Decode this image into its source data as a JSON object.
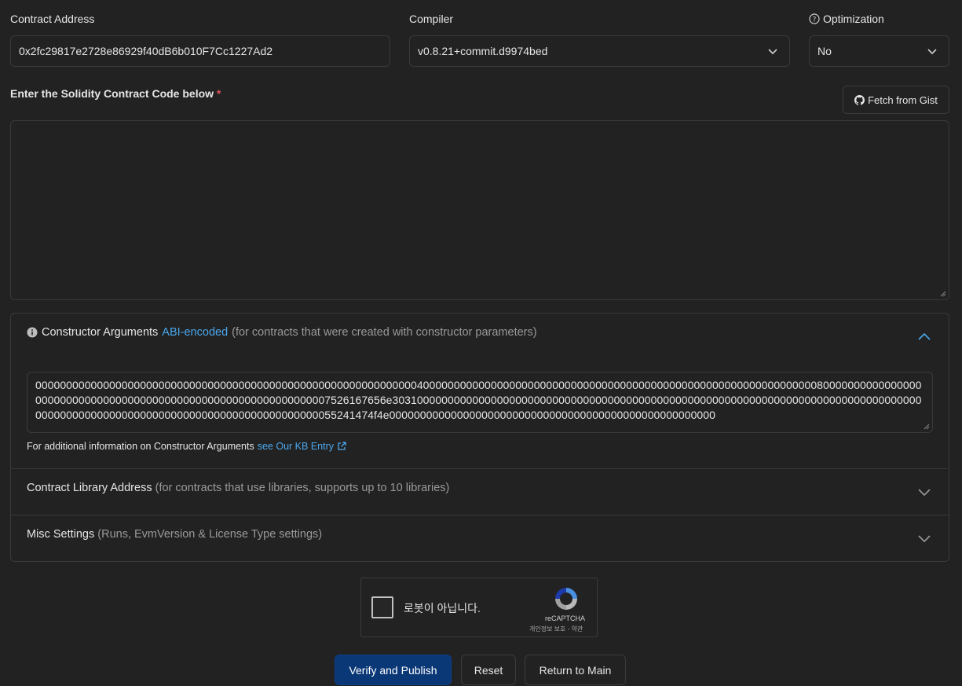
{
  "contract_address": {
    "label": "Contract Address",
    "value": "0x2fc29817e2728e86929f40dB6b010F7Cc1227Ad2"
  },
  "compiler": {
    "label": "Compiler",
    "selected": "v0.8.21+commit.d9974bed"
  },
  "optimization": {
    "label": "Optimization",
    "selected": "No",
    "help_icon": "question-circle-icon"
  },
  "code_section": {
    "label": "Enter the Solidity Contract Code below",
    "required_marker": "*",
    "fetch_button": "Fetch from Gist",
    "fetch_icon": "github-icon",
    "code_value": ""
  },
  "constructor": {
    "title": "Constructor Arguments",
    "link": "ABI-encoded",
    "note": "(for contracts that were created with constructor parameters)",
    "info_icon": "info-circle-icon",
    "args": "000000000000000000000000000000000000000000000000000000000000004000000000000000000000000000000000000000000000000000000000000000080000000000000000000000000000000000000000000000000000000000000007526167656e303100000000000000000000000000000000000000000000000000000000000000000000000000000000000000000000000000000000000000000000000000000000055241474f4e00000000000000000000000000000000000000000000000000000",
    "footer_text": "For additional information on Constructor Arguments",
    "footer_link": "see Our KB Entry",
    "footer_link_icon": "external-link-icon"
  },
  "library": {
    "title": "Contract Library Address",
    "note": "(for contracts that use libraries, supports up to 10 libraries)"
  },
  "misc": {
    "title": "Misc Settings",
    "note": "(Runs, EvmVersion & License Type settings)"
  },
  "captcha": {
    "label": "로봇이 아닙니다.",
    "brand": "reCAPTCHA",
    "links": "개인정보 보호 - 약관"
  },
  "actions": {
    "verify": "Verify and Publish",
    "reset": "Reset",
    "return": "Return to Main"
  },
  "colors": {
    "background": "#222222",
    "accent": "#4aa8f0",
    "primary_button": "#0a3877",
    "required": "#e0505a"
  }
}
